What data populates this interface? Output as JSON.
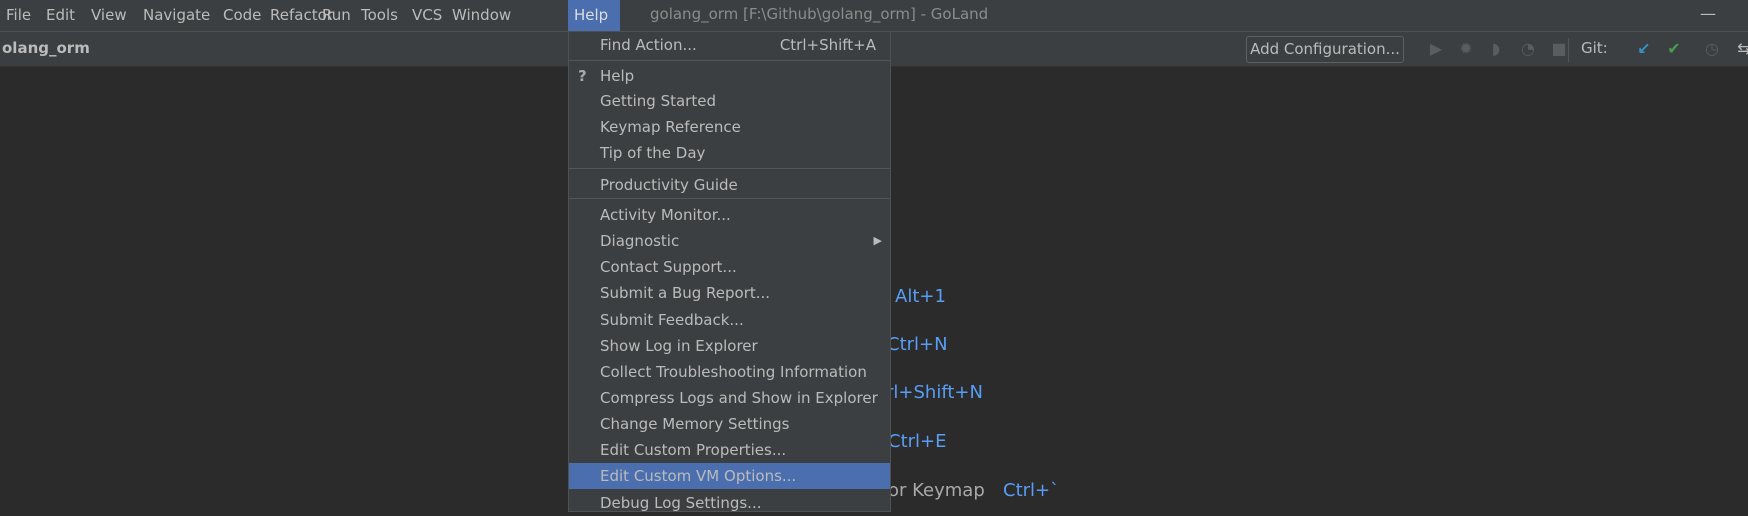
{
  "menubar": {
    "items": [
      "File",
      "Edit",
      "View",
      "Navigate",
      "Code",
      "Refactor",
      "Run",
      "Tools",
      "VCS",
      "Window",
      "Help"
    ],
    "active": "Help"
  },
  "window": {
    "title": "golang_orm [F:\\Github\\golang_orm] - GoLand",
    "minimize": "—"
  },
  "toolbar": {
    "project": "olang_orm",
    "add_configuration": "Add Configuration...",
    "git_label": "Git:",
    "icons": [
      "run-icon",
      "debug-icon",
      "coverage-icon",
      "profile-icon",
      "stop-icon"
    ],
    "git_icons": [
      "git-update-icon",
      "git-commit-icon",
      "git-history-icon",
      "git-rollback-icon"
    ]
  },
  "hints": [
    {
      "text": "Alt+1"
    },
    {
      "text": "Ctrl+N"
    },
    {
      "text": "rl+Shift+N"
    },
    {
      "text": "Ctrl+E"
    },
    {
      "text": "or Keymap",
      "shortcut": "Ctrl+`"
    }
  ],
  "help_menu": {
    "find_action": {
      "label": "Find Action...",
      "shortcut": "Ctrl+Shift+A"
    },
    "help": {
      "label": "Help",
      "icon": "?"
    },
    "items1": [
      "Getting Started",
      "Keymap Reference",
      "Tip of the Day"
    ],
    "productivity": "Productivity Guide",
    "items2": [
      "Activity Monitor...",
      "Diagnostic",
      "Contact Support...",
      "Submit a Bug Report...",
      "Submit Feedback...",
      "Show Log in Explorer",
      "Collect Troubleshooting Information",
      "Compress Logs and Show in Explorer",
      "Change Memory Settings",
      "Edit Custom Properties...",
      "Edit Custom VM Options...",
      "Debug Log Settings..."
    ],
    "selected": "Edit Custom VM Options..."
  },
  "colors": {
    "accent": "#4b6eaf",
    "hint_blue": "#589df6",
    "git_update": "#3592c4",
    "git_commit": "#499c54"
  }
}
